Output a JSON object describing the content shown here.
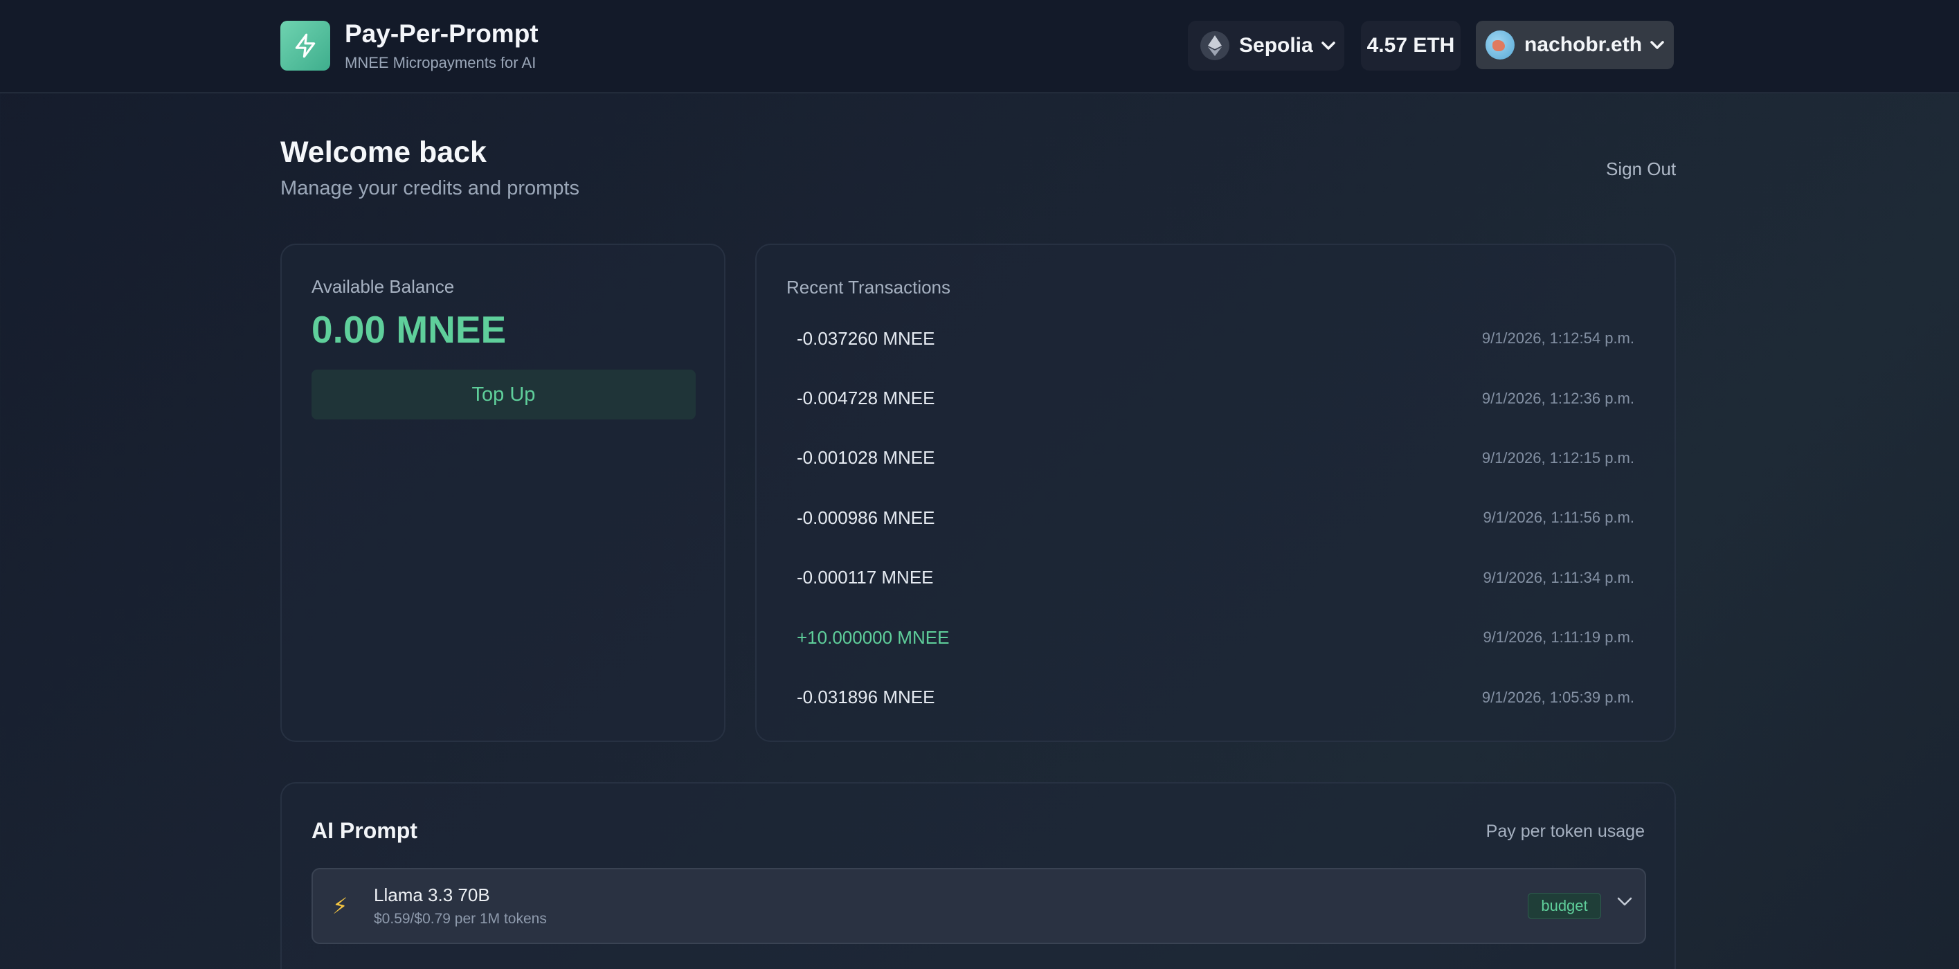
{
  "header": {
    "app_title": "Pay-Per-Prompt",
    "app_subtitle": "MNEE Micropayments for AI",
    "network_label": "Sepolia",
    "eth_balance": "4.57 ETH",
    "account_name": "nachobr.eth",
    "icons": [
      "lightning-icon",
      "ethereum-icon",
      "chevron-down-icon",
      "avatar"
    ]
  },
  "welcome": {
    "title": "Welcome back",
    "subtitle": "Manage your credits and prompts",
    "sign_out": "Sign Out"
  },
  "balance": {
    "label": "Available Balance",
    "value": "0.00 MNEE",
    "top_up_label": "Top Up"
  },
  "transactions": {
    "title": "Recent Transactions",
    "items": [
      {
        "amount": "-0.037260 MNEE",
        "time": "9/1/2026, 1:12:54 p.m."
      },
      {
        "amount": "-0.004728 MNEE",
        "time": "9/1/2026, 1:12:36 p.m."
      },
      {
        "amount": "-0.001028 MNEE",
        "time": "9/1/2026, 1:12:15 p.m."
      },
      {
        "amount": "-0.000986 MNEE",
        "time": "9/1/2026, 1:11:56 p.m."
      },
      {
        "amount": "-0.000117 MNEE",
        "time": "9/1/2026, 1:11:34 p.m."
      },
      {
        "amount": "+10.000000 MNEE",
        "time": "9/1/2026, 1:11:19 p.m."
      },
      {
        "amount": "-0.031896 MNEE",
        "time": "9/1/2026, 1:05:39 p.m."
      }
    ]
  },
  "prompt": {
    "title": "AI Prompt",
    "note": "Pay per token usage",
    "model_name": "Llama 3.3 70B",
    "model_price": "$0.59/$0.79 per 1M tokens",
    "model_badge": "budget"
  },
  "colors": {
    "accent": "#5fcf9b",
    "background": "#1b2433",
    "card_border": "#273142"
  }
}
